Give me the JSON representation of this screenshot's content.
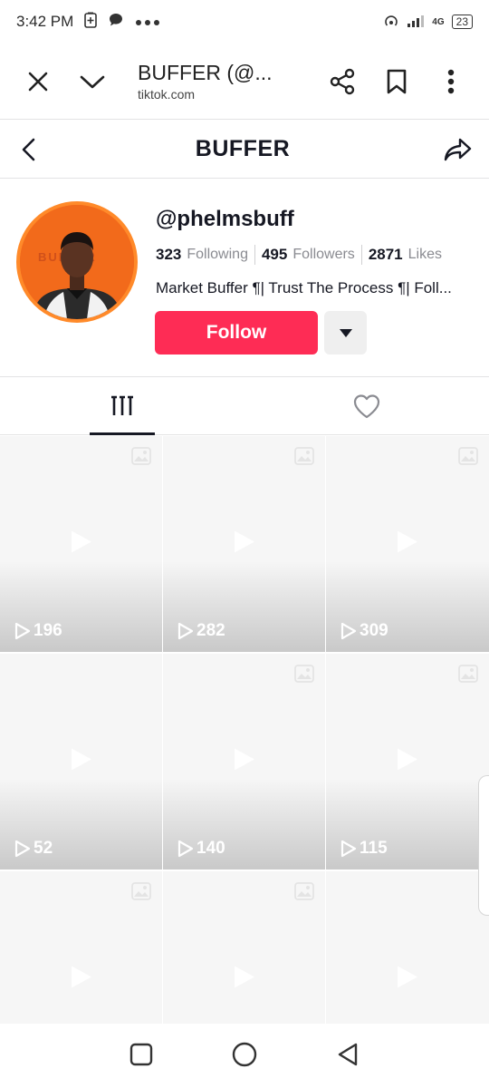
{
  "status_bar": {
    "time": "3:42 PM",
    "signal_label": "4G",
    "battery": "23"
  },
  "browser": {
    "page_title": "BUFFER (@...",
    "domain": "tiktok.com"
  },
  "header": {
    "title": "BUFFER"
  },
  "profile": {
    "username": "@phelmsbuff",
    "stats": [
      {
        "value": "323",
        "label": "Following"
      },
      {
        "value": "495",
        "label": "Followers"
      },
      {
        "value": "2871",
        "label": "Likes"
      }
    ],
    "bio": "Market Buffer ¶| Trust The Process ¶| Foll...",
    "follow_label": "Follow",
    "avatar_text": "BUFFER"
  },
  "videos": [
    {
      "views": "196",
      "has_image_badge": true
    },
    {
      "views": "282",
      "has_image_badge": true
    },
    {
      "views": "309",
      "has_image_badge": true
    },
    {
      "views": "52",
      "has_image_badge": false
    },
    {
      "views": "140",
      "has_image_badge": true
    },
    {
      "views": "115",
      "has_image_badge": true
    },
    {
      "views": "",
      "has_image_badge": true
    },
    {
      "views": "",
      "has_image_badge": true
    },
    {
      "views": "",
      "has_image_badge": false
    }
  ],
  "colors": {
    "follow": "#fe2c55",
    "text": "#161823",
    "muted": "#8a8b91",
    "avatar": "#f26a1b"
  }
}
